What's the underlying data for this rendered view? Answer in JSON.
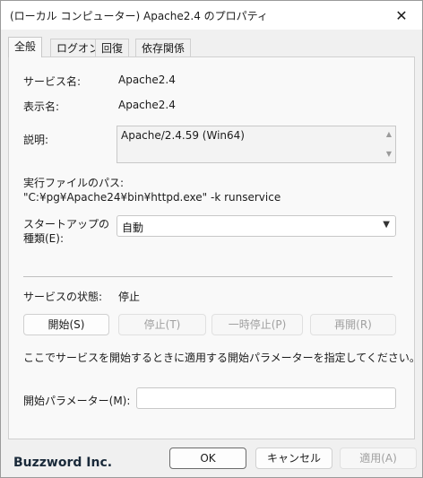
{
  "window": {
    "title": "(ローカル コンピューター) Apache2.4 のプロパティ",
    "close_glyph": "✕"
  },
  "tabs": [
    {
      "label": "全般",
      "active": true
    },
    {
      "label": "ログオン"
    },
    {
      "label": "回復"
    },
    {
      "label": "依存関係"
    }
  ],
  "general": {
    "service_name_label": "サービス名:",
    "service_name_value": "Apache2.4",
    "display_name_label": "表示名:",
    "display_name_value": "Apache2.4",
    "description_label": "説明:",
    "description_value": "Apache/2.4.59 (Win64)",
    "exe_path_label": "実行ファイルのパス:",
    "exe_path_value": "\"C:¥pg¥Apache24¥bin¥httpd.exe\" -k runservice",
    "startup_type_label_line1": "スタートアップの",
    "startup_type_label_line2": "種類(E):",
    "startup_type_value": "自動",
    "status_label": "サービスの状態:",
    "status_value": "停止",
    "buttons": {
      "start": "開始(S)",
      "stop": "停止(T)",
      "pause": "一時停止(P)",
      "resume": "再開(R)"
    },
    "hint_text": "ここでサービスを開始するときに適用する開始パラメーターを指定してください。",
    "start_params_label": "開始パラメーター(M):",
    "start_params_value": ""
  },
  "footer": {
    "brand": "Buzzword Inc.",
    "ok": "OK",
    "cancel": "キャンセル",
    "apply": "適用(A)"
  },
  "icons": {
    "dropdown": "chevron-down-icon",
    "scroll_up": "scroll-up-arrow-icon",
    "scroll_down": "scroll-down-arrow-icon"
  }
}
